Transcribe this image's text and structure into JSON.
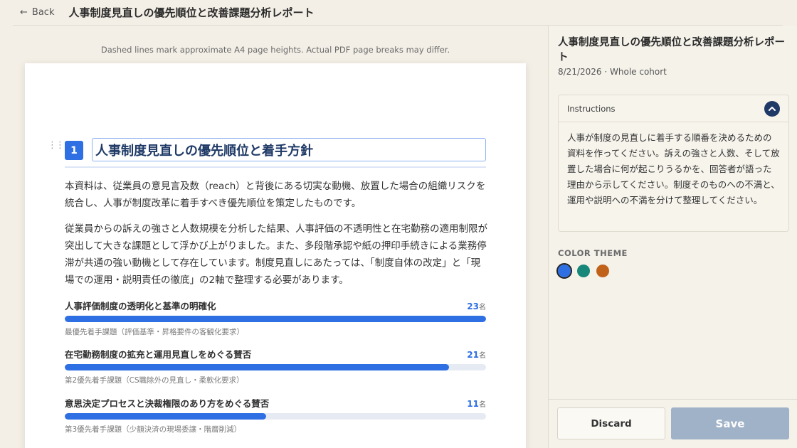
{
  "topbar": {
    "back_label": "Back",
    "title": "人事制度見直しの優先順位と改善課題分析レポート"
  },
  "editor": {
    "hint": "Dashed lines mark approximate A4 page heights. Actual PDF page breaks may differ.",
    "section": {
      "number": "1",
      "heading": "人事制度見直しの優先順位と着手方針",
      "paragraphs": [
        "本資料は、従業員の意見言及数（reach）と背後にある切実な動機、放置した場合の組織リスクを統合し、人事が制度改革に着手すべき優先順位を策定したものです。",
        "従業員からの訴えの強さと人数規模を分析した結果、人事評価の不透明性と在宅勤務の適用制限が突出して大きな課題として浮かび上がりました。また、多段階承認や紙の押印手続きによる業務停滞が共通の強い動機として存在しています。制度見直しにあたっては、「制度自体の改定」と「現場での運用・説明責任の徹底」の2軸で整理する必要があります。"
      ],
      "metrics": [
        {
          "label": "人事評価制度の透明化と基準の明確化",
          "count": "23",
          "unit": "名",
          "fraction": 1.0,
          "sub": "最優先着手課題（評価基準・昇格要件の客観化要求）"
        },
        {
          "label": "在宅勤務制度の拡充と運用見直しをめぐる賛否",
          "count": "21",
          "unit": "名",
          "fraction": 0.913,
          "sub": "第2優先着手課題（CS職除外の見直し・柔軟化要求）"
        },
        {
          "label": "意思決定プロセスと決裁権限のあり方をめぐる賛否",
          "count": "11",
          "unit": "名",
          "fraction": 0.478,
          "sub": "第3優先着手課題（少額決済の現場委譲・階層削減）"
        }
      ]
    }
  },
  "side": {
    "title": "人事制度見直しの優先順位と改善課題分析レポート",
    "date": "8/21/2026",
    "separator": "·",
    "cohort": "Whole cohort",
    "instructions_label": "Instructions",
    "instructions_text": "人事が制度の見直しに着手する順番を決めるための資料を作ってください。訴えの強さと人数、そして放置した場合に何が起こりうるかを、回答者が語った理由から示してください。制度そのものへの不満と、運用や説明への不満を分けて整理してください。",
    "theme_label": "COLOR THEME",
    "themes": [
      {
        "name": "blue",
        "color": "#2f6fe4",
        "selected": true
      },
      {
        "name": "teal",
        "color": "#17877a",
        "selected": false
      },
      {
        "name": "orange",
        "color": "#c0621a",
        "selected": false
      }
    ],
    "discard_label": "Discard",
    "save_label": "Save"
  }
}
